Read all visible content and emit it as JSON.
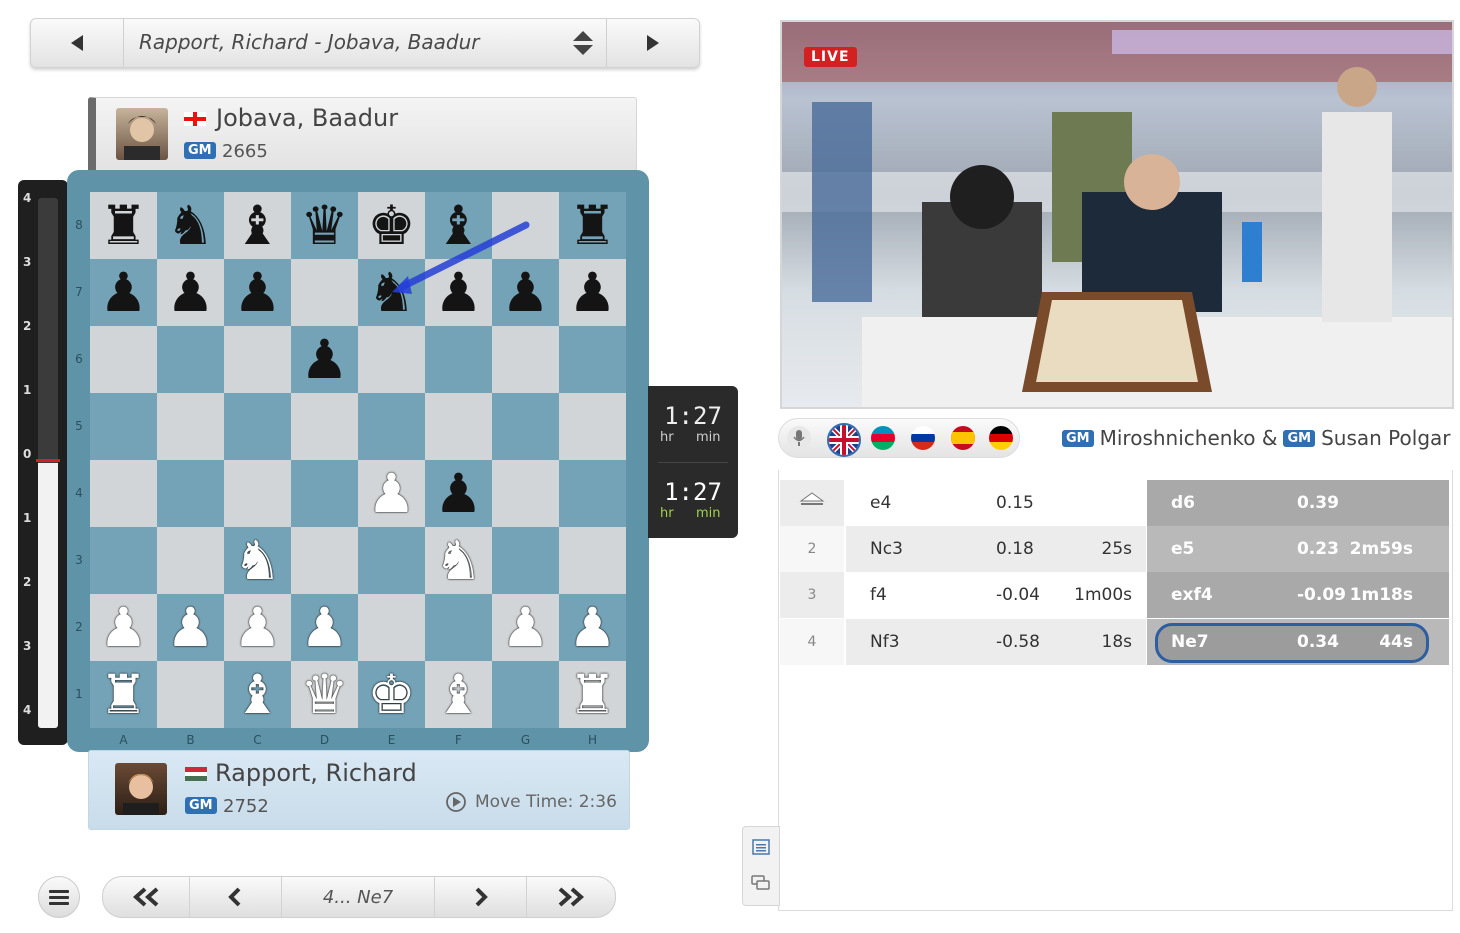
{
  "game_selector": {
    "title": "Rapport, Richard - Jobava, Baadur"
  },
  "player_top": {
    "name": "Jobava, Baadur",
    "title": "GM",
    "rating": "2665",
    "flag": "georgia-flag"
  },
  "player_bottom": {
    "name": "Rapport, Richard",
    "title": "GM",
    "rating": "2752",
    "flag": "hungary-flag",
    "move_time": "Move Time: 2:36"
  },
  "eval_bar": {
    "ticks": [
      "4",
      "3",
      "2",
      "1",
      "0",
      "1",
      "2",
      "3",
      "4"
    ],
    "value": 0
  },
  "board": {
    "ranks": [
      "8",
      "7",
      "6",
      "5",
      "4",
      "3",
      "2",
      "1"
    ],
    "files": [
      "A",
      "B",
      "C",
      "D",
      "E",
      "F",
      "G",
      "H"
    ],
    "position": [
      [
        "r",
        "n",
        "b",
        "q",
        "k",
        "b",
        "",
        "r"
      ],
      [
        "p",
        "p",
        "p",
        "",
        "n",
        "p",
        "p",
        "p"
      ],
      [
        "",
        "",
        "",
        "p",
        "",
        "",
        "",
        ""
      ],
      [
        "",
        "",
        "",
        "",
        "",
        "",
        "",
        ""
      ],
      [
        "",
        "",
        "",
        "",
        "P",
        "p",
        "",
        ""
      ],
      [
        "",
        "",
        "N",
        "",
        "",
        "N",
        "",
        ""
      ],
      [
        "P",
        "P",
        "P",
        "P",
        "",
        "",
        "P",
        "P"
      ],
      [
        "R",
        "",
        "B",
        "Q",
        "K",
        "B",
        "",
        "R"
      ]
    ],
    "last_move": "g8-e7"
  },
  "clocks": {
    "top": {
      "time": "1:27",
      "units": [
        "hr",
        "min"
      ]
    },
    "bottom": {
      "time": "1:27",
      "units": [
        "hr",
        "min"
      ]
    }
  },
  "navigation": {
    "current_move": "4... Ne7"
  },
  "video": {
    "live_label": "LIVE"
  },
  "languages": [
    "microphone-icon",
    "uk-flag",
    "azerbaijan-flag",
    "russia-flag",
    "spain-flag",
    "germany-flag"
  ],
  "commentators": {
    "badge": "GM",
    "first": "Miroshnichenko &",
    "second": "Susan Polgar"
  },
  "moves": [
    {
      "num": "",
      "white": "e4",
      "white_eval": "0.15",
      "white_time": "",
      "black": "d6",
      "black_eval": "0.39",
      "black_time": ""
    },
    {
      "num": "2",
      "white": "Nc3",
      "white_eval": "0.18",
      "white_time": "25s",
      "black": "e5",
      "black_eval": "0.23",
      "black_time": "2m59s"
    },
    {
      "num": "3",
      "white": "f4",
      "white_eval": "-0.04",
      "white_time": "1m00s",
      "black": "exf4",
      "black_eval": "-0.09",
      "black_time": "1m18s"
    },
    {
      "num": "4",
      "white": "Nf3",
      "white_eval": "-0.58",
      "white_time": "18s",
      "black": "Ne7",
      "black_eval": "0.34",
      "black_time": "44s"
    }
  ],
  "colors": {
    "accent": "#2f6fb3",
    "board_light": "#d1d5d7",
    "board_dark": "#74a3b8",
    "live": "#d32020"
  }
}
